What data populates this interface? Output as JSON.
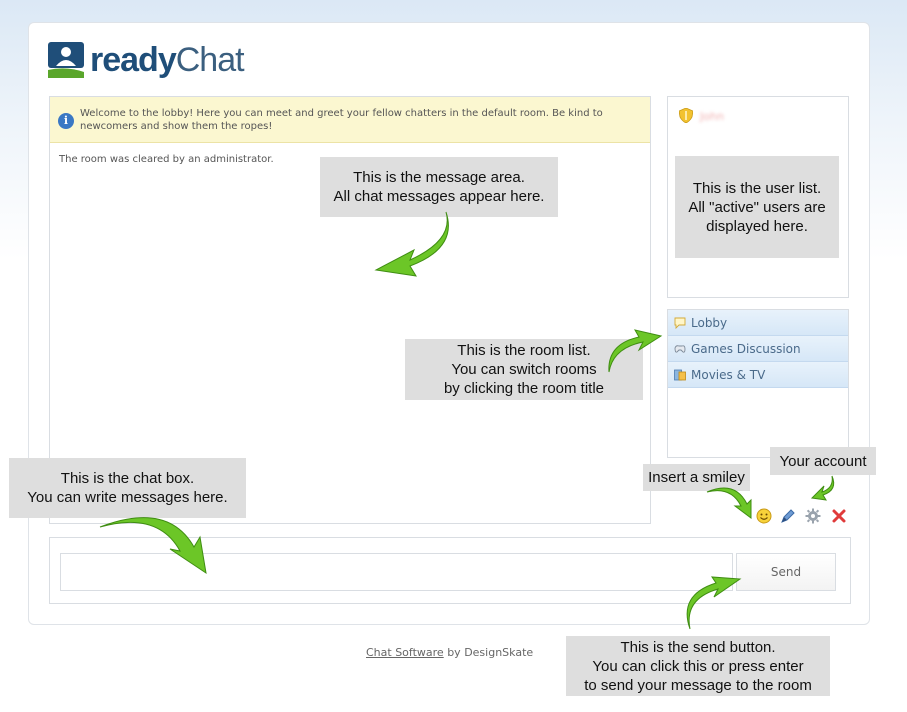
{
  "logo": {
    "part1": "ready",
    "part2": "Chat"
  },
  "welcome": {
    "text": "Welcome to the lobby! Here you can meet and greet your fellow chatters in the default room. Be kind to newcomers and show them the ropes!"
  },
  "messages": [
    {
      "text": "The room was cleared by an administrator."
    }
  ],
  "users": [
    {
      "name": "John",
      "icon": "shield-icon"
    }
  ],
  "rooms": [
    {
      "label": "Lobby",
      "icon": "speech-bubble-icon"
    },
    {
      "label": "Games Discussion",
      "icon": "gamepad-icon"
    },
    {
      "label": "Movies & TV",
      "icon": "film-icon"
    }
  ],
  "toolbar": {
    "smiley": "smiley-icon",
    "account": "pencil-icon",
    "settings": "gear-icon",
    "logout": "close-icon"
  },
  "input": {
    "value": "",
    "placeholder": ""
  },
  "send_label": "Send",
  "footer": {
    "link": "Chat Software",
    "suffix": "by DesignSkate"
  },
  "annotations": {
    "message_area": "This is the message area.\nAll chat messages appear here.",
    "user_list": "This is the user list.\nAll \"active\" users are\ndisplayed here.",
    "room_list": "This is the room list.\nYou can switch rooms\nby clicking the room title",
    "chat_box": "This is the chat box.\nYou can write messages here.",
    "smiley": "Insert a smiley",
    "account": "Your account",
    "send": "This is the send button.\nYou can click this or press enter\nto send your message to the room"
  },
  "colors": {
    "brand_dark": "#1f4e79",
    "brand_green": "#5aa62b",
    "arrow_green": "#6cc627",
    "welcome_bg": "#fbf7d0",
    "room_bg": "#d6e7f7"
  }
}
